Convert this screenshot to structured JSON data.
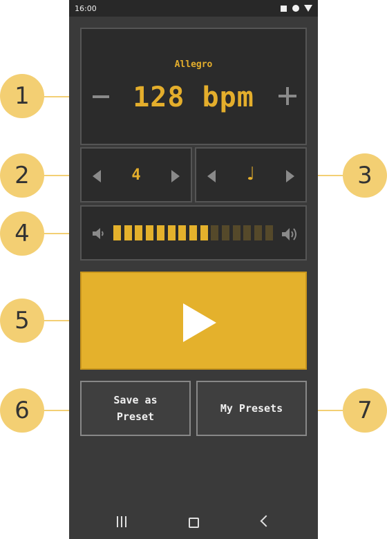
{
  "status_bar": {
    "time": "16:00"
  },
  "tempo": {
    "marking": "Allegro",
    "display": "128 bpm",
    "bpm": 128
  },
  "time_signature": {
    "beats": "4"
  },
  "note_value": {
    "glyph": "♩",
    "name": "quarter-note"
  },
  "volume": {
    "level": 9,
    "max": 15,
    "on_color": "#e4b12c",
    "off_color": "#55492a"
  },
  "play": {
    "icon": "play-icon"
  },
  "actions": {
    "save_label": "Save as Preset",
    "presets_label": "My Presets"
  },
  "callouts": [
    "1",
    "2",
    "3",
    "4",
    "5",
    "6",
    "7"
  ],
  "colors": {
    "accent": "#e4b12c",
    "callout": "#f3cf73",
    "background": "#3a3a3a",
    "panel": "#2b2b2b"
  }
}
